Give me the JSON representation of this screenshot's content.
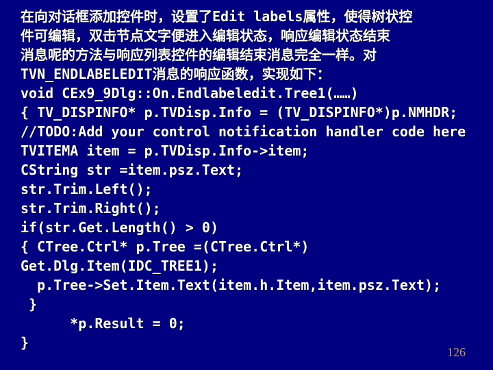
{
  "lines": [
    "在向对话框添加控件时，设置了Edit labels属性，使得树状控",
    "件可编辑，双击节点文字便进入编辑状态，响应编辑状态结束",
    "消息呢的方法与响应列表控件的编辑结束消息完全一样。对",
    "TVN_ENDLABELEDIT消息的响应函数，实现如下：",
    "void CEx9_9Dlg::On.Endlabeledit.Tree1(……)",
    "{ TV_DISPINFO* p.TVDisp.Info = (TV_DISPINFO*)p.NMHDR;",
    "//TODO:Add your control notification handler code here",
    "TVITEMA item = p.TVDisp.Info->item;",
    "CString str =item.psz.Text;",
    "str.Trim.Left();",
    "str.Trim.Right();",
    "if(str.Get.Length() > 0)",
    "{ CTree.Ctrl* p.Tree =(CTree.Ctrl*) Get.Dlg.Item(IDC_TREE1);",
    "  p.Tree->Set.Item.Text(item.h.Item,item.psz.Text);",
    " }",
    "      *p.Result = 0;",
    "}"
  ],
  "page_number": "126"
}
